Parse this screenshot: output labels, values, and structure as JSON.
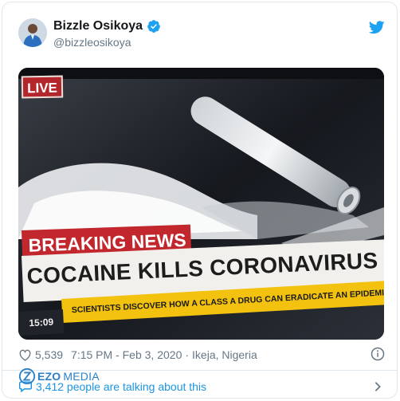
{
  "tweet": {
    "author": {
      "display_name": "Bizzle Osikoya",
      "handle": "@bizzleosikoya",
      "verified": true,
      "avatar_icon": "person-avatar"
    },
    "platform_icon": "twitter-bird-icon",
    "media": {
      "live_badge": "LIVE",
      "breaking_label": "BREAKING NEWS",
      "headline": "COCAINE KILLS CORONAVIRUS",
      "ticker": "SCIENTISTS DISCOVER HOW A CLASS A DRUG CAN ERADICATE AN EPIDEMIC",
      "time": "15:09"
    },
    "meta": {
      "likes": "5,539",
      "timestamp": "7:15 PM - Feb 3, 2020",
      "separator": "·",
      "location": "Ikeja, Nigeria"
    },
    "footer": {
      "talking_text": "3,412 people are talking about this"
    }
  },
  "watermark": {
    "brand": "EZO",
    "suffix": "MEDIA"
  },
  "colors": {
    "accent": "#1da1f2",
    "text_secondary": "#657786",
    "breaking_red": "#c1272d",
    "ticker_yellow": "#f2c20f"
  }
}
